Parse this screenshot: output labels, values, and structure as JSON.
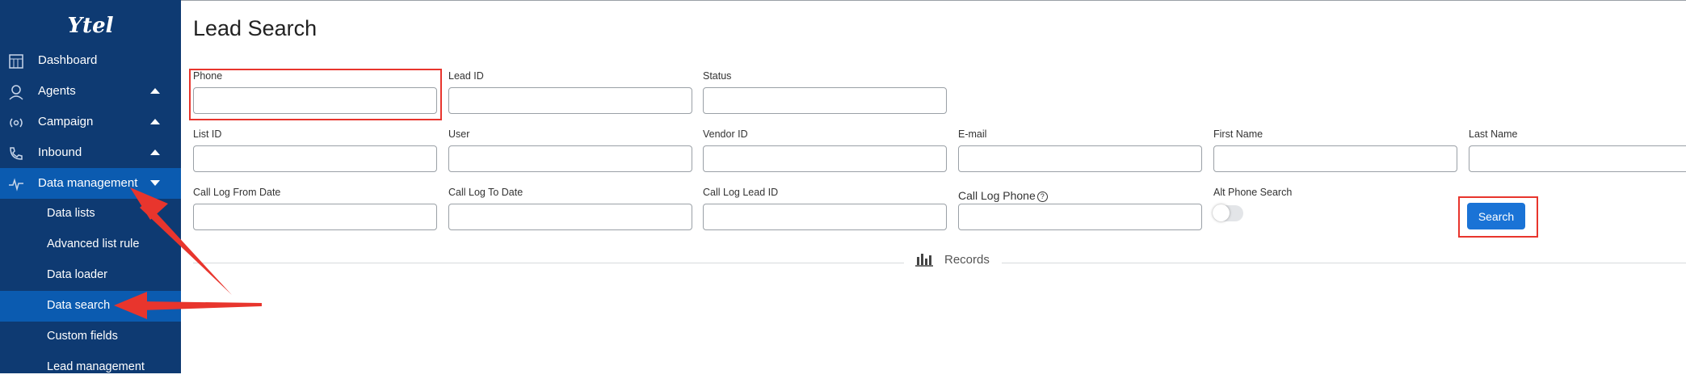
{
  "sidebar": {
    "logo_text": "Ytel",
    "items": [
      {
        "label": "Dashboard",
        "icon": "dashboard-icon"
      },
      {
        "label": "Agents",
        "icon": "agent-icon",
        "caret": "up"
      },
      {
        "label": "Campaign",
        "icon": "broadcast-icon",
        "caret": "up"
      },
      {
        "label": "Inbound",
        "icon": "phone-icon",
        "caret": "up"
      },
      {
        "label": "Data management",
        "icon": "pulse-icon",
        "caret": "down"
      }
    ],
    "subitems": [
      {
        "label": "Data lists"
      },
      {
        "label": "Advanced list rule"
      },
      {
        "label": "Data loader"
      },
      {
        "label": "Data search",
        "active": true
      },
      {
        "label": "Custom fields"
      },
      {
        "label": "Lead management"
      }
    ]
  },
  "page": {
    "title": "Lead Search"
  },
  "form": {
    "phone_label": "Phone",
    "lead_id_label": "Lead ID",
    "status_label": "Status",
    "list_id_label": "List ID",
    "user_label": "User",
    "vendor_id_label": "Vendor ID",
    "email_label": "E-mail",
    "first_name_label": "First Name",
    "last_name_label": "Last Name",
    "call_log_from_label": "Call Log From Date",
    "call_log_to_label": "Call Log To Date",
    "call_log_lead_id_label": "Call Log Lead ID",
    "call_log_phone_label": "Call Log Phone",
    "alt_phone_search_label": "Alt Phone Search",
    "alt_phone_search_enabled": false,
    "search_button": "Search"
  },
  "records": {
    "label": "Records"
  },
  "colors": {
    "sidebar_bg": "#0e3a72",
    "active_bg": "#0b5bb0",
    "button_bg": "#1a73d6",
    "annotation_red": "#e8352d"
  }
}
